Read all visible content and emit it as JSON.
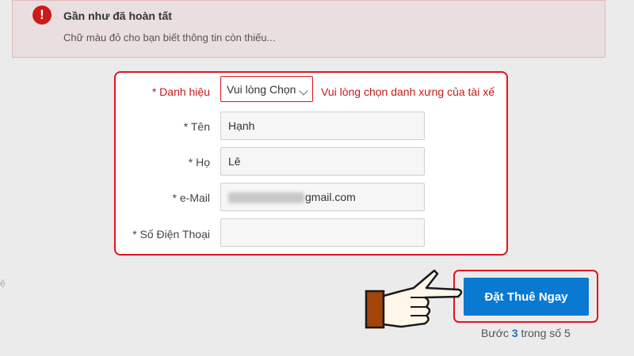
{
  "alert": {
    "icon": "exclamation-circle-icon",
    "glyph": "!",
    "title": "Gần như đã hoàn tất",
    "body": "Chữ màu đỏ cho bạn biết thông tin còn thiếu..."
  },
  "form": {
    "title_label": "* Danh hiệu",
    "title_select_value": "Vui lòng Chọn",
    "title_error": "Vui lòng chọn danh xưng của tài xế",
    "first_name_label": "* Tên",
    "first_name_value": "Hạnh",
    "last_name_label": "* Họ",
    "last_name_value": "Lê",
    "email_label": "* e-Mail",
    "email_visible_part": "gmail.com",
    "phone_label": "* Số Điện Thoại",
    "phone_value": ""
  },
  "side_mark": "ệ",
  "cta": {
    "label": "Đặt Thuê Ngay"
  },
  "step": {
    "prefix": "Bước",
    "current": "3",
    "middle": "trong số",
    "total": "5"
  },
  "colors": {
    "error_red": "#e0141e",
    "primary_blue": "#0a79d1",
    "alert_bg": "#e9dfe0"
  },
  "icons": {
    "pointer": "pointing-hand-icon",
    "dropdown": "chevron-down-icon"
  }
}
